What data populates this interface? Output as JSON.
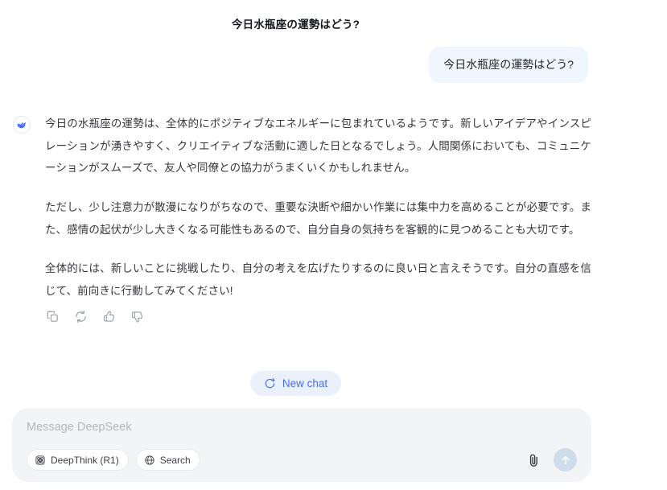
{
  "header": {
    "title": "今日水瓶座の運勢はどう?"
  },
  "conversation": {
    "user_message": "今日水瓶座の運勢はどう?",
    "assistant": {
      "avatar_icon": "deepseek-whale-icon",
      "paragraphs": [
        "今日の水瓶座の運勢は、全体的にポジティブなエネルギーに包まれているようです。新しいアイデアやインスピレーションが湧きやすく、クリエイティブな活動に適した日となるでしょう。人間関係においても、コミュニケーションがスムーズで、友人や同僚との協力がうまくいくかもしれません。",
        "ただし、少し注意力が散漫になりがちなので、重要な決断や細かい作業には集中力を高めることが必要です。また、感情の起伏が少し大きくなる可能性もあるので、自分自身の気持ちを客観的に見つめることも大切です。",
        "全体的には、新しいことに挑戦したり、自分の考えを広げたりするのに良い日と言えそうです。自分の直感を信じて、前向きに行動してみてください!"
      ],
      "actions": [
        {
          "name": "copy-icon",
          "label": "Copy"
        },
        {
          "name": "regenerate-icon",
          "label": "Regenerate"
        },
        {
          "name": "thumbs-up-icon",
          "label": "Good response"
        },
        {
          "name": "thumbs-down-icon",
          "label": "Bad response"
        }
      ]
    }
  },
  "new_chat": {
    "label": "New chat",
    "icon": "new-chat-icon"
  },
  "composer": {
    "placeholder": "Message DeepSeek",
    "value": "",
    "tools": [
      {
        "label": "DeepThink (R1)",
        "icon": "deepthink-icon"
      },
      {
        "label": "Search",
        "icon": "globe-icon"
      }
    ],
    "attach_icon": "paperclip-icon",
    "send_icon": "arrow-up-icon"
  },
  "colors": {
    "user_bubble": "#eff6fd",
    "brand_blue": "#4a6fe0",
    "new_chat_bg": "#eaf1fd",
    "composer_bg": "#f3f4f6",
    "send_button": "#cfdcec"
  }
}
